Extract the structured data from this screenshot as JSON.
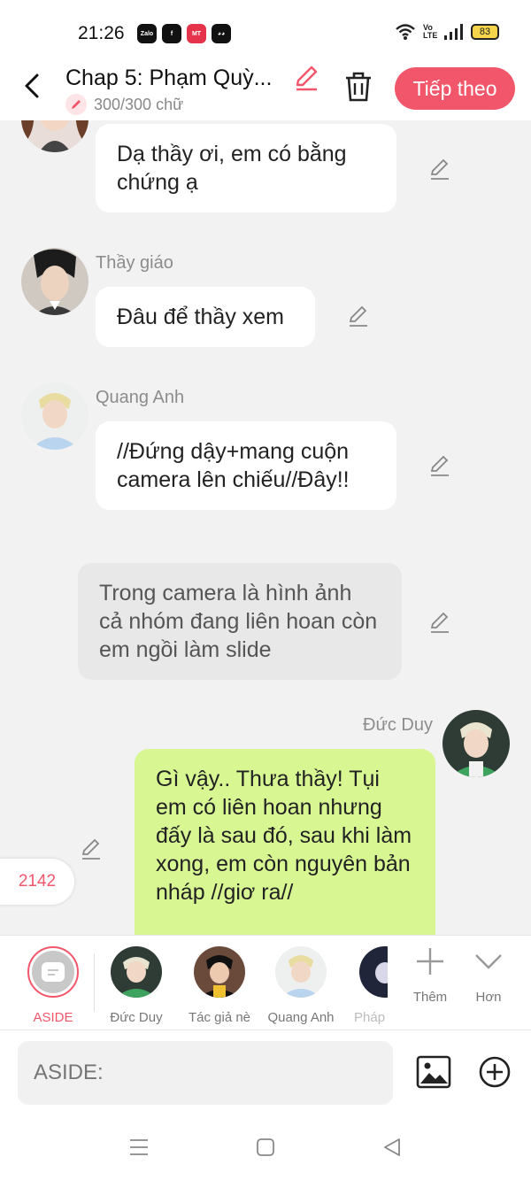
{
  "status_bar": {
    "time": "21:26",
    "app_icons": [
      "Zalo",
      "facebook",
      "MANGA TOON",
      "cat"
    ],
    "battery": "83",
    "volte": "Vo LTE"
  },
  "header": {
    "title": "Chap 5: Phạm Quỳ...",
    "word_count": "300/300 chữ",
    "next_label": "Tiếp theo"
  },
  "messages": [
    {
      "sender": "",
      "text": "Dạ thầy ơi, em có bằng chứng ạ",
      "type": "left"
    },
    {
      "sender": "Thầy giáo",
      "text": "Đâu để thầy xem",
      "type": "left"
    },
    {
      "sender": "Quang Anh",
      "text": "//Đứng dậy+mang cuộn camera lên chiếu//Đây!!",
      "type": "left"
    },
    {
      "sender": "",
      "text": "Trong camera là hình ảnh cả nhóm đang liên hoan còn em ngồi làm slide",
      "type": "narration"
    },
    {
      "sender": "Đức Duy",
      "text": "Gì vậy.. Thưa thầy! Tụi em có liên hoan nhưng đấy là sau đó, sau khi làm xong, em còn nguyên bản nháp //giơ ra//",
      "type": "right"
    }
  ],
  "counter": "2142",
  "characters": [
    {
      "label": "ASIDE"
    },
    {
      "label": "Đức Duy"
    },
    {
      "label": "Tác giả nè"
    },
    {
      "label": "Quang Anh"
    },
    {
      "label": "Pháp"
    }
  ],
  "tools": {
    "add_label": "Thêm",
    "more_label": "Hơn"
  },
  "input": {
    "placeholder": "ASIDE:"
  },
  "colors": {
    "accent": "#f2566b",
    "my_bubble": "#d8f793",
    "narration": "#e8e8e8"
  }
}
